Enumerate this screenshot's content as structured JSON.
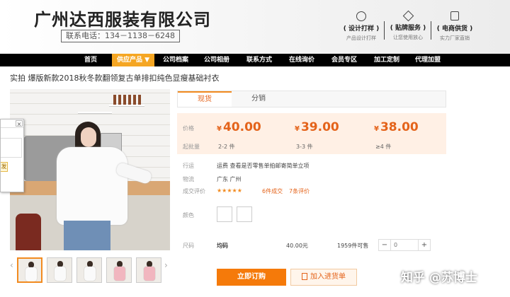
{
  "header": {
    "company_name": "广州达西服装有限公司",
    "phone": "联系电话：134－1138－6248",
    "features": [
      {
        "icon": "design-sample-icon",
        "title": "( 设计打样 )",
        "subtitle": "产品设计打样"
      },
      {
        "icon": "diamond-icon",
        "title": "( 贴牌服务 )",
        "subtitle": "让您使用放心"
      },
      {
        "icon": "shopping-bag-icon",
        "title": "( 电商供货 )",
        "subtitle": "实力厂家直销"
      }
    ]
  },
  "nav": {
    "items": [
      {
        "label": "首页",
        "active": false
      },
      {
        "label": "供应产品 ▼",
        "active": true
      },
      {
        "label": "公司档案",
        "active": false
      },
      {
        "label": "公司相册",
        "active": false
      },
      {
        "label": "联系方式",
        "active": false
      },
      {
        "label": "在线询价",
        "active": false
      },
      {
        "label": "会员专区",
        "active": false
      },
      {
        "label": "加工定制",
        "active": false
      },
      {
        "label": "代理加盟",
        "active": false
      }
    ]
  },
  "product": {
    "title": "实拍 爆版新款2018秋冬款翻领复古单排扣纯色显瘦基础衬衣"
  },
  "popup": {
    "close": "×",
    "tag": "发"
  },
  "gallery": {
    "prev": "‹",
    "next": "›"
  },
  "tabs": [
    {
      "label": "现货",
      "active": true
    },
    {
      "label": "分销",
      "active": false
    }
  ],
  "pricing": {
    "price_label": "价格",
    "moq_label": "起批量",
    "currency": "¥",
    "tiers": [
      {
        "price": "40.00",
        "range": "2-2",
        "unit": "件"
      },
      {
        "price": "39.00",
        "range": "3-3",
        "unit": "件"
      },
      {
        "price": "38.00",
        "range": "≥4",
        "unit": "件"
      }
    ]
  },
  "shipping": {
    "freight_label": "行运",
    "freight_value": "运费 查看是否零售单拍邮寄简单立项",
    "origin_label": "物流",
    "origin_value": "广东 广州",
    "rating_label": "成交评价",
    "stars": "★★★★★",
    "sold": "6件成交",
    "reviews": "7条评价"
  },
  "options": {
    "color_label": "颜色",
    "size_label": "尺码",
    "size_name": "均码",
    "size_price": "40.00元",
    "stock": "1959件可售",
    "quantity": "0",
    "minus": "−",
    "plus": "+"
  },
  "actions": {
    "order": "立即订购",
    "cart": "加入进货单"
  },
  "watermark": "知乎 @苏博士"
}
